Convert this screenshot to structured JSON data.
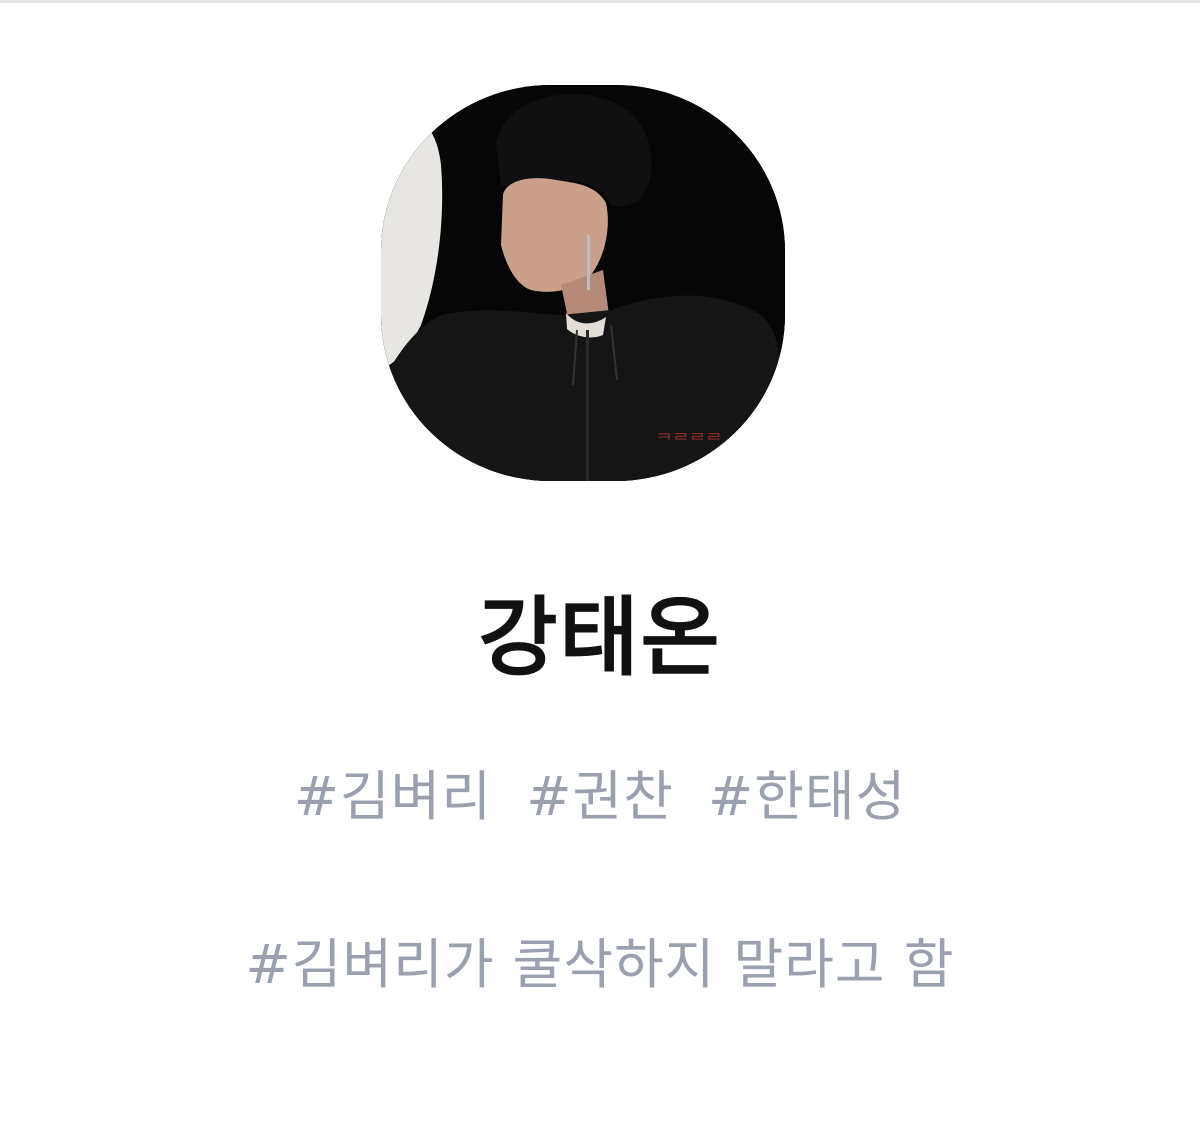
{
  "profile": {
    "avatar_icon": "profile-photo",
    "name": "강태온",
    "tags": [
      "#김벼리",
      "#권찬",
      "#한태성"
    ],
    "status": "#김벼리가 쿨삭하지 말라고 함"
  },
  "colors": {
    "background": "#ffffff",
    "name": "#111111",
    "tags": "#9aa0ae"
  }
}
